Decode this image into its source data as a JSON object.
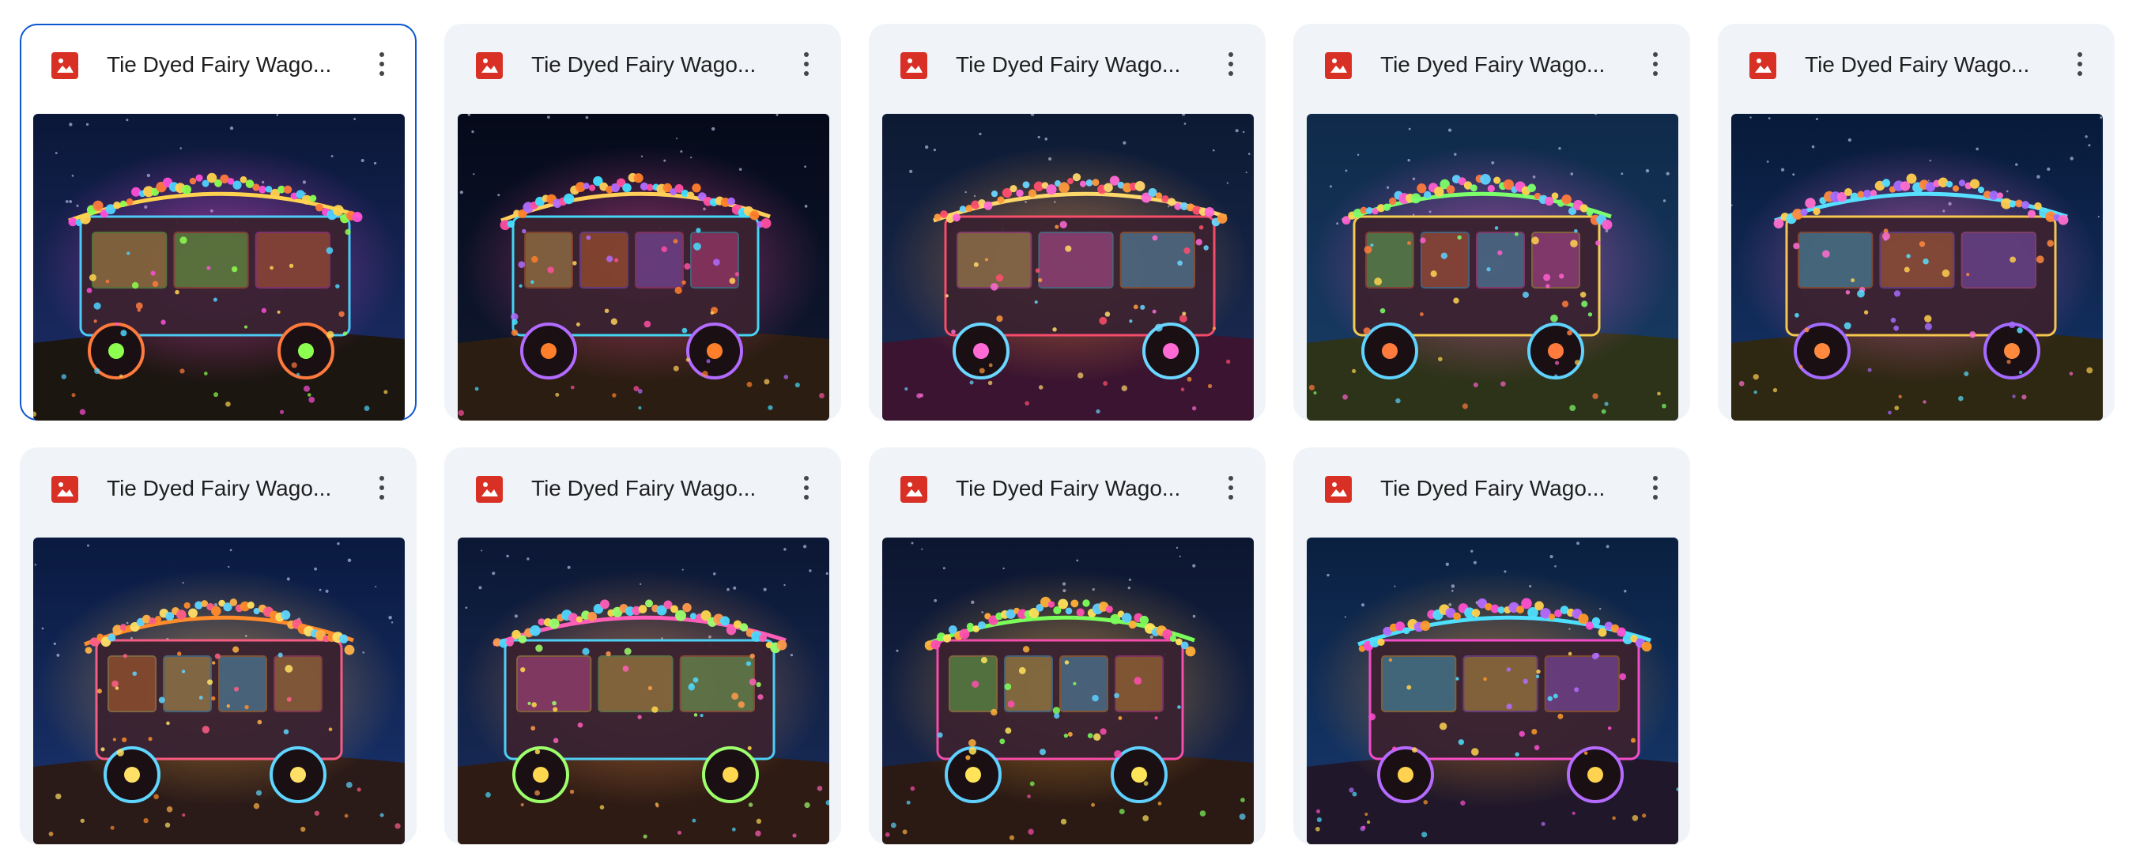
{
  "files": [
    {
      "title": "Tie Dyed Fairy Wago...",
      "selected": true,
      "icon": "image-file-icon",
      "thumbnail": "tie-dyed-fairy-wagon-1"
    },
    {
      "title": "Tie Dyed Fairy Wago...",
      "selected": false,
      "icon": "image-file-icon",
      "thumbnail": "tie-dyed-fairy-wagon-2"
    },
    {
      "title": "Tie Dyed Fairy Wago...",
      "selected": false,
      "icon": "image-file-icon",
      "thumbnail": "tie-dyed-fairy-wagon-3"
    },
    {
      "title": "Tie Dyed Fairy Wago...",
      "selected": false,
      "icon": "image-file-icon",
      "thumbnail": "tie-dyed-fairy-wagon-4"
    },
    {
      "title": "Tie Dyed Fairy Wago...",
      "selected": false,
      "icon": "image-file-icon",
      "thumbnail": "tie-dyed-fairy-wagon-5"
    },
    {
      "title": "Tie Dyed Fairy Wago...",
      "selected": false,
      "icon": "image-file-icon",
      "thumbnail": "tie-dyed-fairy-wagon-6"
    },
    {
      "title": "Tie Dyed Fairy Wago...",
      "selected": false,
      "icon": "image-file-icon",
      "thumbnail": "tie-dyed-fairy-wagon-7"
    },
    {
      "title": "Tie Dyed Fairy Wago...",
      "selected": false,
      "icon": "image-file-icon",
      "thumbnail": "tie-dyed-fairy-wagon-8"
    },
    {
      "title": "Tie Dyed Fairy Wago...",
      "selected": false,
      "icon": "image-file-icon",
      "thumbnail": "tie-dyed-fairy-wagon-9"
    }
  ],
  "colors": {
    "card_background": "#f0f4f9",
    "selected_border": "#0b57d0",
    "image_icon": "#d93025",
    "title_text": "#1f1f1f",
    "more_icon": "#444746"
  }
}
